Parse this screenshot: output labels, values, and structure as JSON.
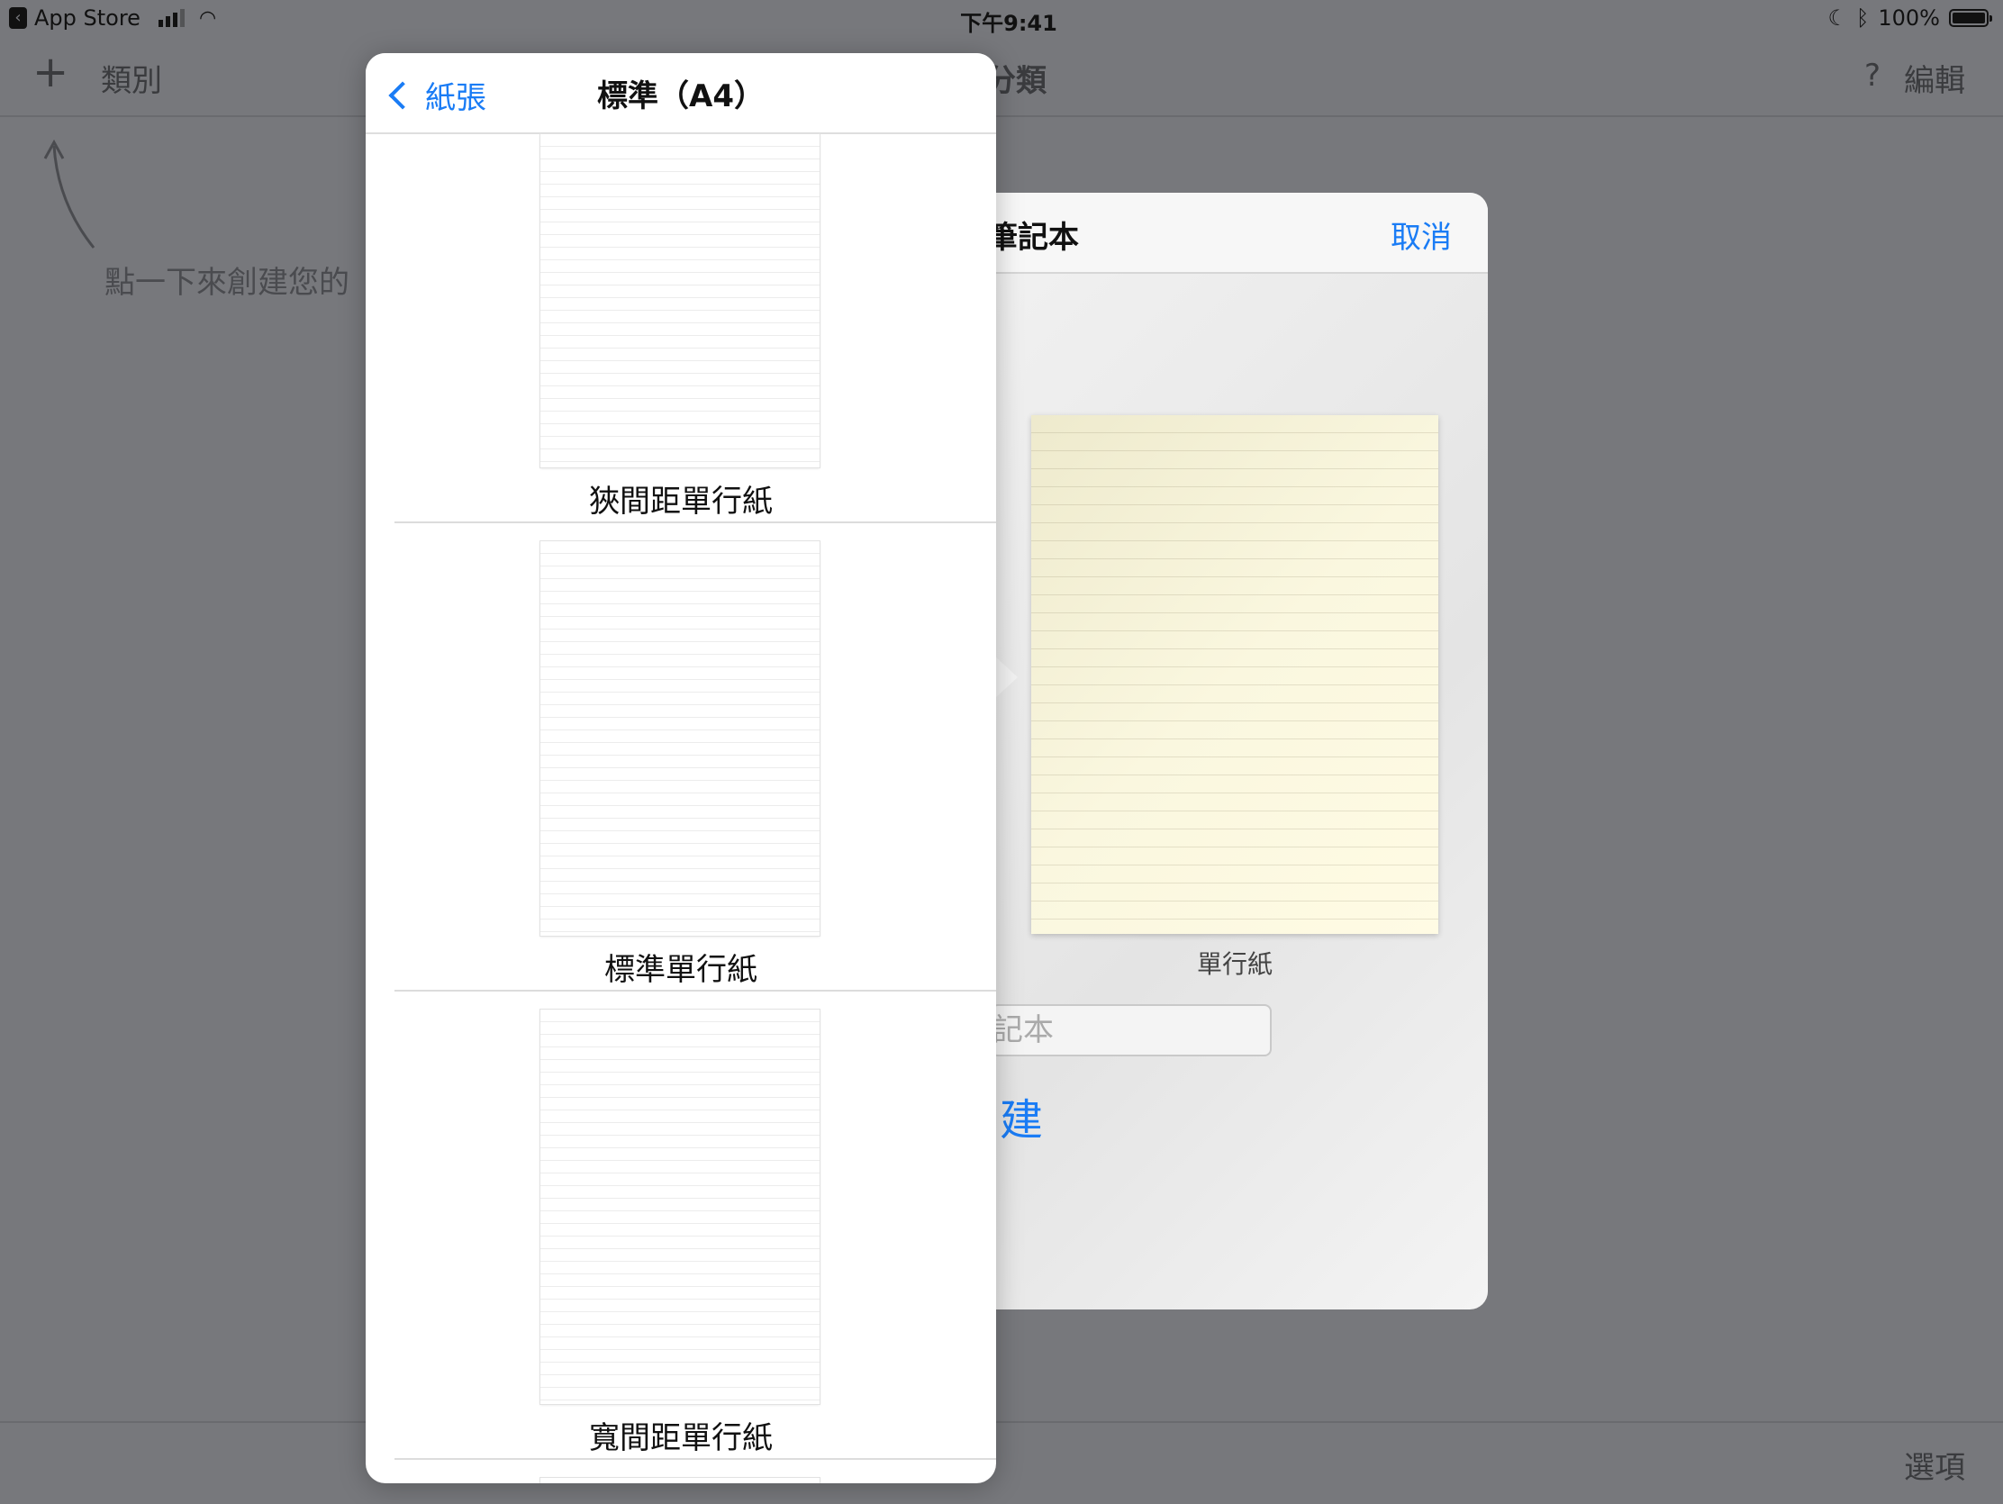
{
  "status_bar": {
    "back_app": "App Store",
    "time": "下午9:41",
    "battery": "100%"
  },
  "background": {
    "add_glyph": "+",
    "category_label": "類別",
    "center_title": "分類",
    "help_glyph": "?",
    "edit_label": "編輯",
    "hint_text": "點一下來創建您的",
    "options_label": "選項"
  },
  "new_notebook_sheet": {
    "title": "筆記本",
    "cancel_label": "取消",
    "paper_name": "單行紙",
    "name_placeholder": "記本",
    "create_label": "建"
  },
  "paper_picker": {
    "back_label": "紙張",
    "title": "標準（A4）",
    "items": [
      {
        "label": "狹間距單行紙"
      },
      {
        "label": "標準單行紙"
      },
      {
        "label": "寬間距單行紙"
      }
    ]
  },
  "colors": {
    "accent": "#1a7cf5",
    "dim_background": "#77787c",
    "preview_paper": "#faf7df"
  }
}
